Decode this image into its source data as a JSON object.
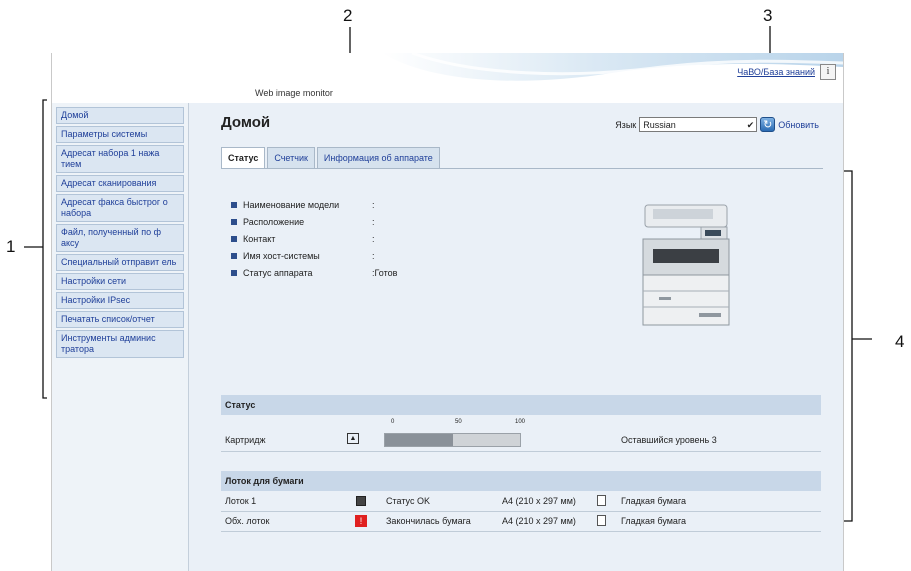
{
  "callouts": [
    "1",
    "2",
    "3",
    "4"
  ],
  "header": {
    "title": "Web image monitor",
    "faq_link": "ЧаВО/База знаний",
    "info_icon": "info-icon"
  },
  "sidebar": {
    "items": [
      {
        "label": "Домой"
      },
      {
        "label": "Параметры системы"
      },
      {
        "label": "Адресат набора 1 нажа тием"
      },
      {
        "label": "Адресат сканирования"
      },
      {
        "label": "Адресат факса быстрог о набора"
      },
      {
        "label": "Файл, полученный по ф аксу"
      },
      {
        "label": "Специальный отправит ель"
      },
      {
        "label": "Настройки сети"
      },
      {
        "label": "Настройки IPsec"
      },
      {
        "label": "Печатать список/отчет"
      },
      {
        "label": "Инструменты админис тратора"
      }
    ]
  },
  "main": {
    "page_title": "Домой",
    "language_label": "Язык",
    "language_value": "Russian",
    "refresh_label": "Обновить",
    "tabs": [
      {
        "label": "Статус",
        "active": true
      },
      {
        "label": "Счетчик",
        "active": false
      },
      {
        "label": "Информация об аппарате",
        "active": false
      }
    ],
    "info": [
      {
        "label": "Наименование модели",
        "value": ":"
      },
      {
        "label": "Расположение",
        "value": ":"
      },
      {
        "label": "Контакт",
        "value": ":"
      },
      {
        "label": "Имя хост-системы",
        "value": ":"
      },
      {
        "label": "Статус аппарата",
        "value": ":Готов"
      }
    ],
    "status_section": {
      "header": "Статус",
      "gauge_ticks": [
        "0",
        "50",
        "100"
      ],
      "cartridge_label": "Картридж",
      "cartridge_level_percent": 50,
      "remaining_text": "Оставшийся уровень 3"
    },
    "tray_section": {
      "header": "Лоток для бумаги",
      "rows": [
        {
          "name": "Лоток 1",
          "status": "Статус OK",
          "size": "A4 (210 x 297 мм)",
          "type": "Гладкая бумага",
          "status_color": "#444444"
        },
        {
          "name": "Обх. лоток",
          "status": "Закончилась бумага",
          "size": "A4 (210 x 297 мм)",
          "type": "Гладкая бумага",
          "status_color": "#e02020"
        }
      ]
    }
  }
}
